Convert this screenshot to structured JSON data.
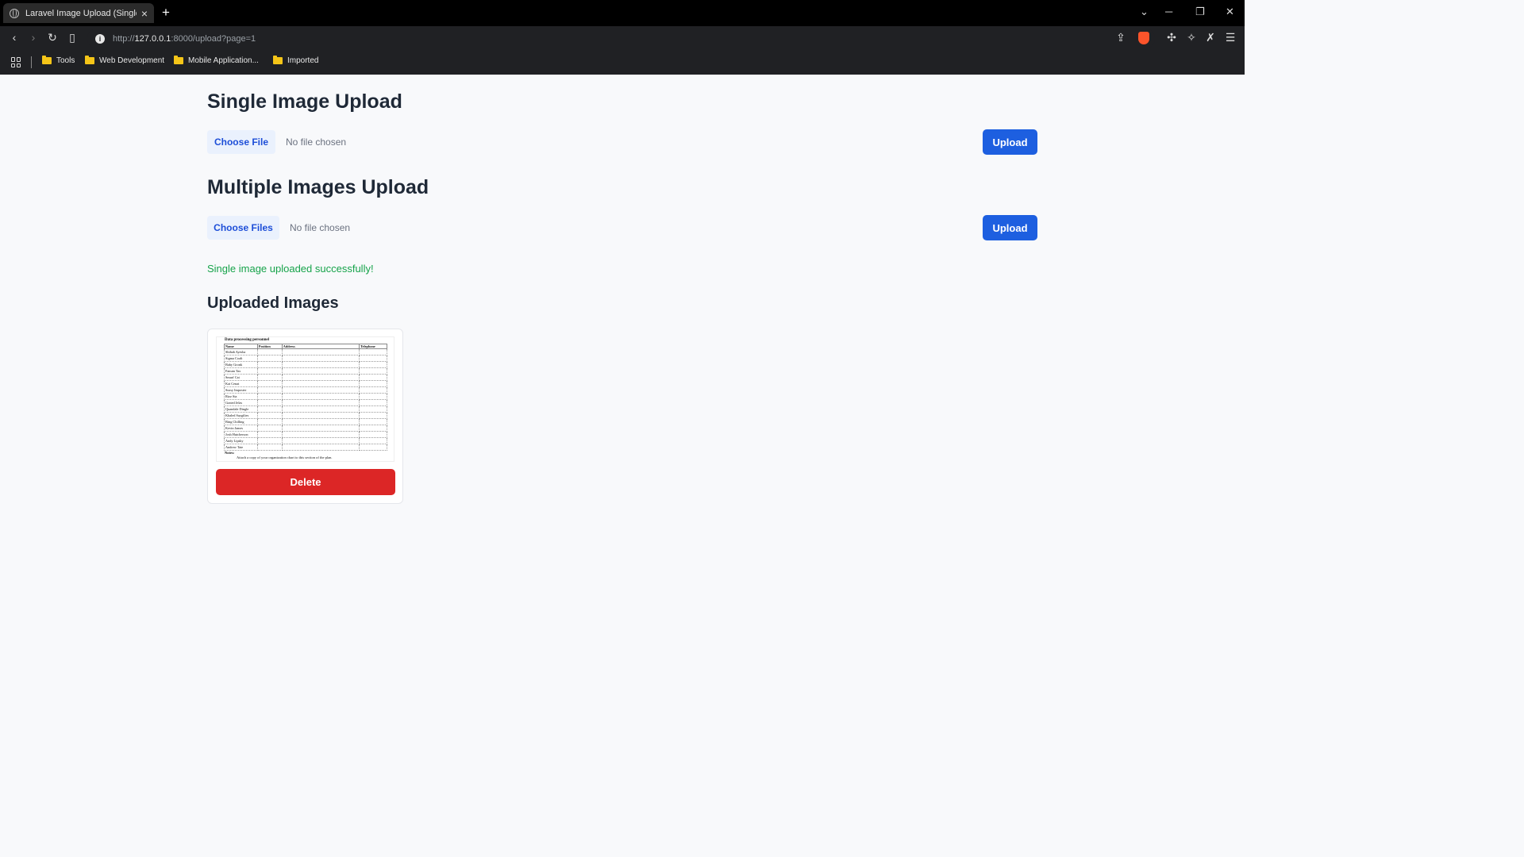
{
  "browser": {
    "tab_title": "Laravel Image Upload (Single",
    "url_prefix": "http://",
    "url_host": "127.0.0.1",
    "url_rest": ":8000/upload?page=1",
    "bookmarks": [
      "Tools",
      "Web Development",
      "Mobile Application...",
      "Imported"
    ]
  },
  "single": {
    "heading": "Single Image Upload",
    "choose_label": "Choose File",
    "no_file": "No file chosen",
    "upload_label": "Upload"
  },
  "multiple": {
    "heading": "Multiple Images Upload",
    "choose_label": "Choose Files",
    "no_file": "No file chosen",
    "upload_label": "Upload"
  },
  "status": {
    "message": "Single image uploaded successfully!"
  },
  "uploaded": {
    "heading": "Uploaded Images",
    "delete_label": "Delete",
    "thumbnail": {
      "title": "Data processing personnel",
      "headers": [
        "Name",
        "Position",
        "Address",
        "Telephone"
      ],
      "names": [
        "Shihab Ayesha",
        "Sigma Coalt",
        "Baby Gronk",
        "Fanum Tax",
        "Smurf Cat",
        "Kai Cenat",
        "Sussy Imposter",
        "Rizz Sia",
        "Grated Jelas",
        "Quandale Dingle",
        "Khaled Saygilies",
        "Bing Chilling",
        "Kevin James",
        "Josh Hutcherson",
        "Andy Lipsky",
        "Andrew Tate"
      ],
      "note": "Notes:",
      "caption": "Attach a copy of your organization chart to this section of the plan."
    }
  },
  "colors": {
    "primary": "#1d5fe0",
    "danger": "#dc2626",
    "success": "#16a34a"
  }
}
